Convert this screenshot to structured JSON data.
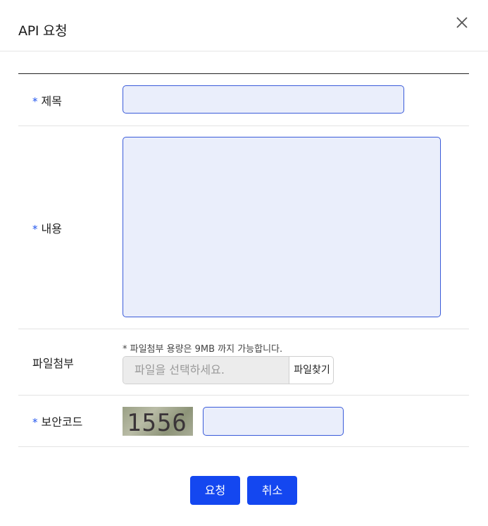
{
  "dialog": {
    "title": "API 요청"
  },
  "form": {
    "required_mark": "*",
    "title_label": "제목",
    "title_value": "",
    "content_label": "내용",
    "content_value": "",
    "file_label": "파일첨부",
    "file_note": "* 파일첨부 용량은 9MB 까지 가능합니다.",
    "file_placeholder": "파일을 선택하세요.",
    "file_button": "파일찾기",
    "captcha_label": "보안코드",
    "captcha_code": "1556",
    "captcha_value": ""
  },
  "buttons": {
    "submit": "요청",
    "cancel": "취소"
  },
  "colors": {
    "accent": "#1447f0",
    "required": "#2255ee",
    "input_bg": "#eaeefb",
    "input_border": "#3a5bd9"
  },
  "icons": {
    "close": "close-icon"
  }
}
